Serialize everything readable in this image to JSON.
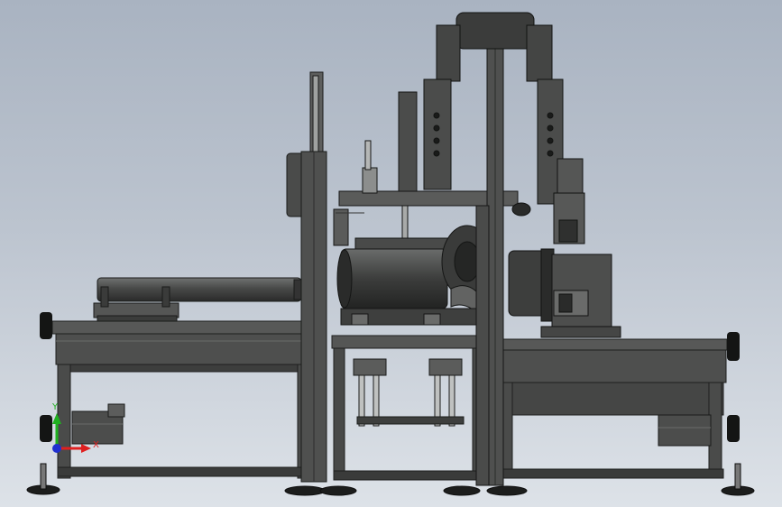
{
  "view": {
    "background_top": "#a9b3c1",
    "background_bottom": "#dde2e8",
    "model_color": "#4a4b4a",
    "model_dark": "#262726",
    "model_light": "#6d6f6e"
  },
  "triad": {
    "x_label": "X",
    "y_label": "Y",
    "x_color": "#e02020",
    "y_color": "#20b020",
    "origin_color": "#2030d0"
  }
}
